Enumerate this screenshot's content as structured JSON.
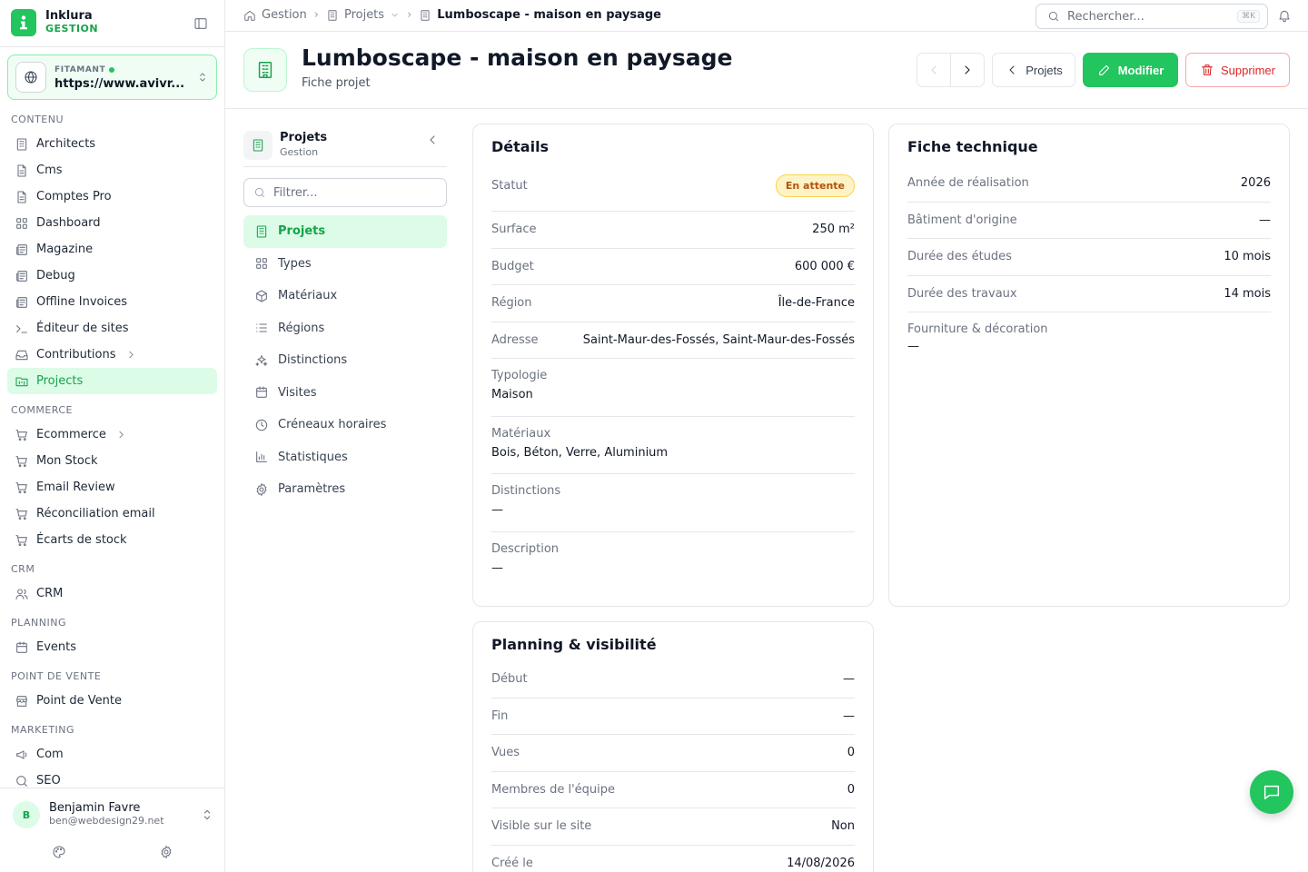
{
  "brand": {
    "name": "Inklura",
    "sub": "GESTION"
  },
  "workspace": {
    "label": "FITAMANT",
    "url": "https://www.avivr..."
  },
  "nav": {
    "groups": [
      {
        "title": "CONTENU",
        "items": [
          {
            "label": "Architects",
            "icon": "building-icon"
          },
          {
            "label": "Cms",
            "icon": "file-icon"
          },
          {
            "label": "Comptes Pro",
            "icon": "file-icon"
          },
          {
            "label": "Dashboard",
            "icon": "grid-icon"
          },
          {
            "label": "Magazine",
            "icon": "newspaper-icon"
          },
          {
            "label": "Debug",
            "icon": "newspaper-icon"
          },
          {
            "label": "Offline Invoices",
            "icon": "newspaper-icon"
          },
          {
            "label": "Éditeur de sites",
            "icon": "terminal-icon"
          },
          {
            "label": "Contributions",
            "icon": "inbox-icon",
            "expandable": true
          },
          {
            "label": "Projects",
            "icon": "folder-kanban-icon",
            "active": true
          }
        ]
      },
      {
        "title": "COMMERCE",
        "items": [
          {
            "label": "Ecommerce",
            "icon": "cart-icon",
            "expandable": true
          },
          {
            "label": "Mon Stock",
            "icon": "cart-icon"
          },
          {
            "label": "Email Review",
            "icon": "cart-icon"
          },
          {
            "label": "Réconciliation email",
            "icon": "cart-icon"
          },
          {
            "label": "Écarts de stock",
            "icon": "cart-icon"
          }
        ]
      },
      {
        "title": "CRM",
        "items": [
          {
            "label": "CRM",
            "icon": "users-icon"
          }
        ]
      },
      {
        "title": "PLANNING",
        "items": [
          {
            "label": "Events",
            "icon": "calendar-icon"
          }
        ]
      },
      {
        "title": "POINT DE VENTE",
        "items": [
          {
            "label": "Point de Vente",
            "icon": "store-icon"
          }
        ]
      },
      {
        "title": "MARKETING",
        "items": [
          {
            "label": "Com",
            "icon": "megaphone-icon"
          },
          {
            "label": "SEO",
            "icon": "search-icon"
          }
        ]
      }
    ]
  },
  "user": {
    "initial": "B",
    "name": "Benjamin Favre",
    "email": "ben@webdesign29.net"
  },
  "breadcrumb": {
    "home": "Gestion",
    "parent": "Projets",
    "current": "Lumboscape - maison en paysage"
  },
  "search": {
    "placeholder": "Rechercher...",
    "shortcut": "⌘K"
  },
  "header": {
    "title": "Lumboscape - maison en paysage",
    "subtitle": "Fiche projet",
    "back_label": "Projets",
    "edit_label": "Modifier",
    "delete_label": "Supprimer"
  },
  "subnav": {
    "title": "Projets",
    "subtitle": "Gestion",
    "filter_placeholder": "Filtrer...",
    "items": [
      {
        "label": "Projets",
        "icon": "building-icon",
        "active": true
      },
      {
        "label": "Types",
        "icon": "grid-icon"
      },
      {
        "label": "Matériaux",
        "icon": "box-icon"
      },
      {
        "label": "Régions",
        "icon": "list-icon"
      },
      {
        "label": "Distinctions",
        "icon": "sparkles-icon"
      },
      {
        "label": "Visites",
        "icon": "calendar-icon"
      },
      {
        "label": "Créneaux horaires",
        "icon": "clock-icon"
      },
      {
        "label": "Statistiques",
        "icon": "bar-chart-icon"
      },
      {
        "label": "Paramètres",
        "icon": "gear-icon"
      }
    ]
  },
  "details": {
    "title": "Détails",
    "status_label": "Statut",
    "status_value": "En attente",
    "rows": [
      {
        "k": "Surface",
        "v": "250 m²"
      },
      {
        "k": "Budget",
        "v": "600 000 €"
      },
      {
        "k": "Région",
        "v": "Île-de-France"
      },
      {
        "k": "Adresse",
        "v": "Saint-Maur-des-Fossés, Saint-Maur-des-Fossés"
      }
    ],
    "stacks": [
      {
        "k": "Typologie",
        "v": "Maison"
      },
      {
        "k": "Matériaux",
        "v": "Bois, Béton, Verre, Aluminium"
      },
      {
        "k": "Distinctions",
        "v": "—"
      },
      {
        "k": "Description",
        "v": "—"
      }
    ]
  },
  "tech": {
    "title": "Fiche technique",
    "rows": [
      {
        "k": "Année de réalisation",
        "v": "2026"
      },
      {
        "k": "Bâtiment d'origine",
        "v": "—"
      },
      {
        "k": "Durée des études",
        "v": "10 mois"
      },
      {
        "k": "Durée des travaux",
        "v": "14 mois"
      }
    ],
    "stack": {
      "k": "Fourniture & décoration",
      "v": "—"
    }
  },
  "planning": {
    "title": "Planning & visibilité",
    "rows": [
      {
        "k": "Début",
        "v": "—"
      },
      {
        "k": "Fin",
        "v": "—"
      },
      {
        "k": "Vues",
        "v": "0"
      },
      {
        "k": "Membres de l'équipe",
        "v": "0"
      },
      {
        "k": "Visible sur le site",
        "v": "Non"
      },
      {
        "k": "Créé le",
        "v": "14/08/2026"
      }
    ]
  },
  "colors": {
    "accent": "#22c55e",
    "accent_dark": "#16a34a",
    "danger": "#dc2626",
    "warning": "#b45309"
  }
}
